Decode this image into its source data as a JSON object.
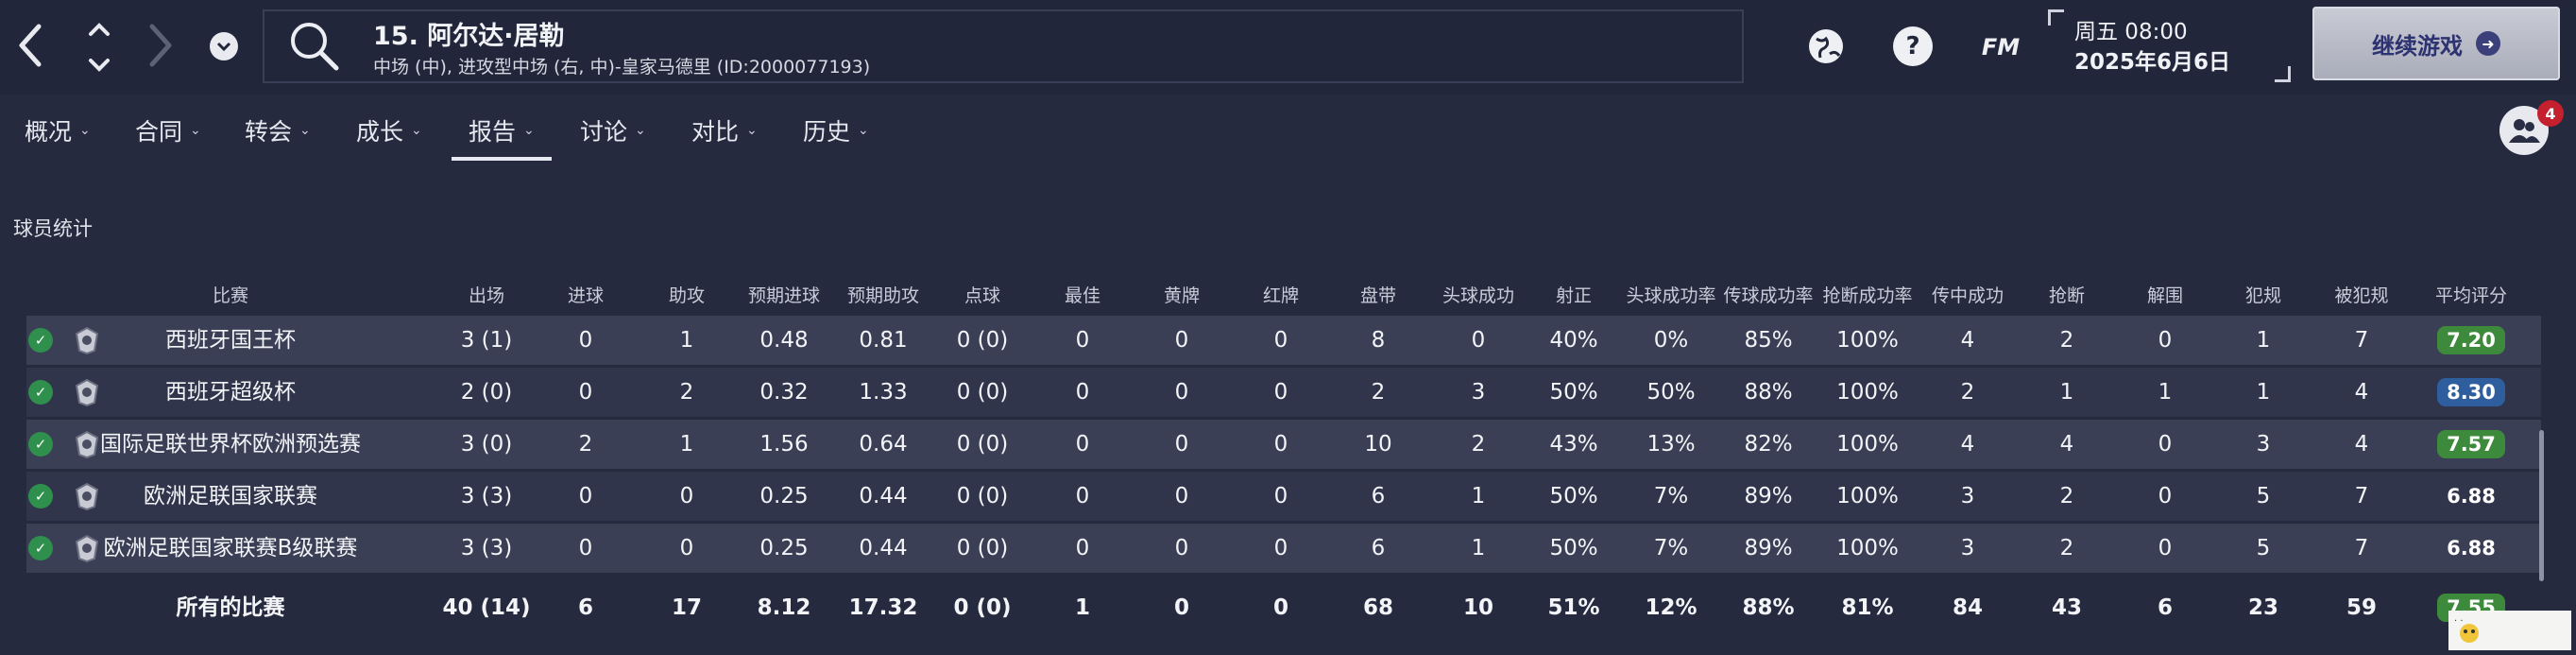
{
  "header": {
    "player_title": "15. 阿尔达·居勒",
    "player_subtitle": "中场 (中), 进攻型中场 (右, 中)-皇家马德里 (ID:2000077193)",
    "fm_label": "FM",
    "day_time": "周五 08:00",
    "date": "2025年6月6日",
    "continue_label": "继续游戏",
    "badge_count": "4"
  },
  "tabs": [
    {
      "label": "概况"
    },
    {
      "label": "合同"
    },
    {
      "label": "转会"
    },
    {
      "label": "成长"
    },
    {
      "label": "报告"
    },
    {
      "label": "讨论"
    },
    {
      "label": "对比"
    },
    {
      "label": "历史"
    }
  ],
  "active_tab": "报告",
  "section_title": "球员统计",
  "table": {
    "columns": [
      "比赛",
      "出场",
      "进球",
      "助攻",
      "预期进球",
      "预期助攻",
      "点球",
      "最佳",
      "黄牌",
      "红牌",
      "盘带",
      "头球成功",
      "射正",
      "头球成功率",
      "传球成功率",
      "抢断成功率",
      "传中成功",
      "抢断",
      "解围",
      "犯规",
      "被犯规",
      "平均评分"
    ],
    "rows": [
      {
        "cells": [
          "西班牙国王杯",
          "3 (1)",
          "0",
          "1",
          "0.48",
          "0.81",
          "0 (0)",
          "0",
          "0",
          "0",
          "8",
          "0",
          "40%",
          "0%",
          "85%",
          "100%",
          "4",
          "2",
          "0",
          "1",
          "7"
        ],
        "rating": "7.20",
        "rating_color": "#3e8a3c"
      },
      {
        "cells": [
          "西班牙超级杯",
          "2 (0)",
          "0",
          "2",
          "0.32",
          "1.33",
          "0 (0)",
          "0",
          "0",
          "0",
          "2",
          "3",
          "50%",
          "50%",
          "88%",
          "100%",
          "2",
          "1",
          "1",
          "1",
          "4"
        ],
        "rating": "8.30",
        "rating_color": "#2f5e9e"
      },
      {
        "cells": [
          "国际足联世界杯欧洲预选赛",
          "3 (0)",
          "2",
          "1",
          "1.56",
          "0.64",
          "0 (0)",
          "0",
          "0",
          "0",
          "10",
          "2",
          "43%",
          "13%",
          "82%",
          "100%",
          "4",
          "4",
          "0",
          "3",
          "4"
        ],
        "rating": "7.57",
        "rating_color": "#3e8a3c"
      },
      {
        "cells": [
          "欧洲足联国家联赛",
          "3 (3)",
          "0",
          "0",
          "0.25",
          "0.44",
          "0 (0)",
          "0",
          "0",
          "0",
          "6",
          "1",
          "50%",
          "7%",
          "89%",
          "100%",
          "3",
          "2",
          "0",
          "5",
          "7"
        ],
        "rating": "6.88",
        "rating_color": ""
      },
      {
        "cells": [
          "欧洲足联国家联赛B级联赛",
          "3 (3)",
          "0",
          "0",
          "0.25",
          "0.44",
          "0 (0)",
          "0",
          "0",
          "0",
          "6",
          "1",
          "50%",
          "7%",
          "89%",
          "100%",
          "3",
          "2",
          "0",
          "5",
          "7"
        ],
        "rating": "6.88",
        "rating_color": ""
      }
    ],
    "totals": [
      "所有的比赛",
      "40 (14)",
      "6",
      "17",
      "8.12",
      "17.32",
      "0 (0)",
      "1",
      "0",
      "0",
      "68",
      "10",
      "51%",
      "12%",
      "88%",
      "81%",
      "84",
      "43",
      "6",
      "23",
      "59"
    ],
    "totals_rating": "7.55"
  }
}
